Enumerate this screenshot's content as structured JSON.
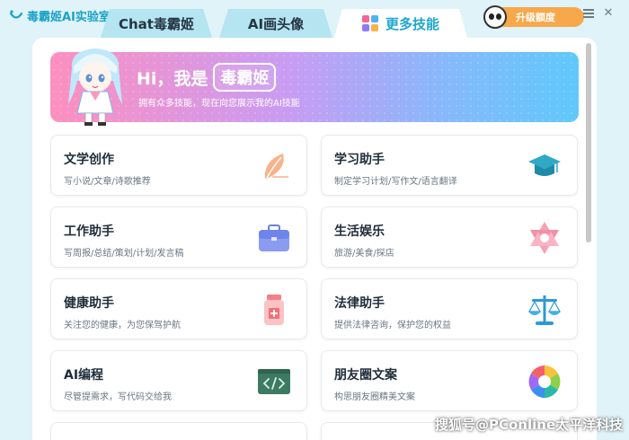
{
  "app": {
    "title": "毒霸姬AI实验室"
  },
  "tabs": [
    {
      "label": "Chat毒霸姬"
    },
    {
      "label": "AI画头像"
    },
    {
      "label": "更多技能"
    }
  ],
  "user": {
    "upgrade_label": "升级额度"
  },
  "banner": {
    "greeting": "Hi，我是",
    "name": "毒霸姬",
    "subtitle": "拥有众多技能，现在向您展示我的AI技能"
  },
  "skills": [
    {
      "title": "文学创作",
      "desc": "写小说/文章/诗歌推荐",
      "icon": "feather-icon"
    },
    {
      "title": "学习助手",
      "desc": "制定学习计划/写作文/语言翻译",
      "icon": "graduation-cap-icon"
    },
    {
      "title": "工作助手",
      "desc": "写周报/总结/策划/计划/发言稿",
      "icon": "briefcase-icon"
    },
    {
      "title": "生活娱乐",
      "desc": "旅游/美食/探店",
      "icon": "star-icon"
    },
    {
      "title": "健康助手",
      "desc": "关注您的健康，为您保驾护航",
      "icon": "medicine-icon"
    },
    {
      "title": "法律助手",
      "desc": "提供法律咨询，保护您的权益",
      "icon": "scales-icon"
    },
    {
      "title": "AI编程",
      "desc": "尽管提需求，写代码交给我",
      "icon": "code-icon"
    },
    {
      "title": "朋友圈文案",
      "desc": "构思朋友圈精美文案",
      "icon": "aperture-icon"
    }
  ],
  "watermark": "搜狐号@PConline太平洋科技",
  "colors": {
    "accent": "#1fa7cf",
    "upgrade": "#f7a84a",
    "background": "#dff3f8"
  }
}
